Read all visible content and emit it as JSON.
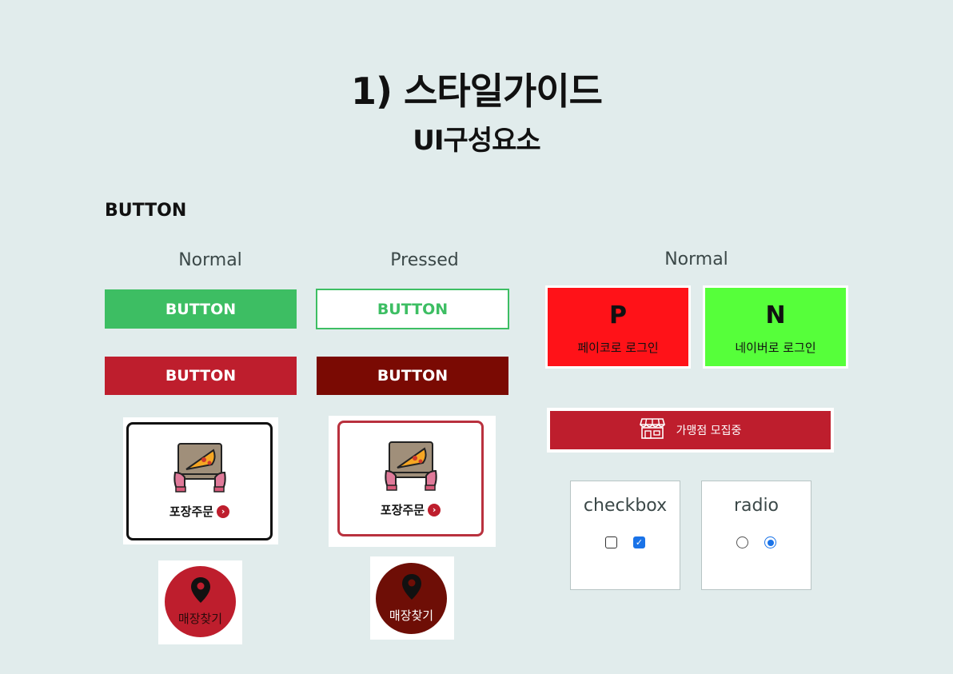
{
  "header": {
    "title": "1) 스타일가이드",
    "subtitle": "UI구성요소"
  },
  "section": {
    "label": "BUTTON"
  },
  "columns": {
    "normal": "Normal",
    "pressed": "Pressed",
    "normal_right": "Normal"
  },
  "buttons": {
    "green_normal": "BUTTON",
    "green_pressed": "BUTTON",
    "red_normal": "BUTTON",
    "red_pressed": "BUTTON"
  },
  "login": {
    "pay_letter": "P",
    "pay_label": "페이코로 로그인",
    "naver_letter": "N",
    "naver_label": "네이버로 로그인"
  },
  "recruit": {
    "label": "가맹점 모집중"
  },
  "tiles": {
    "takeout_normal": "포장주문",
    "takeout_pressed": "포장주문"
  },
  "store": {
    "normal_label": "매장찾기",
    "pressed_label": "매장찾기"
  },
  "controls": {
    "checkbox_title": "checkbox",
    "radio_title": "radio"
  },
  "colors": {
    "background": "#e1ecec",
    "green": "#3dbe63",
    "red": "#be1e2d",
    "dark_red": "#7a0a03",
    "payco_red": "#ff1218",
    "naver_green": "#56ff3a"
  }
}
